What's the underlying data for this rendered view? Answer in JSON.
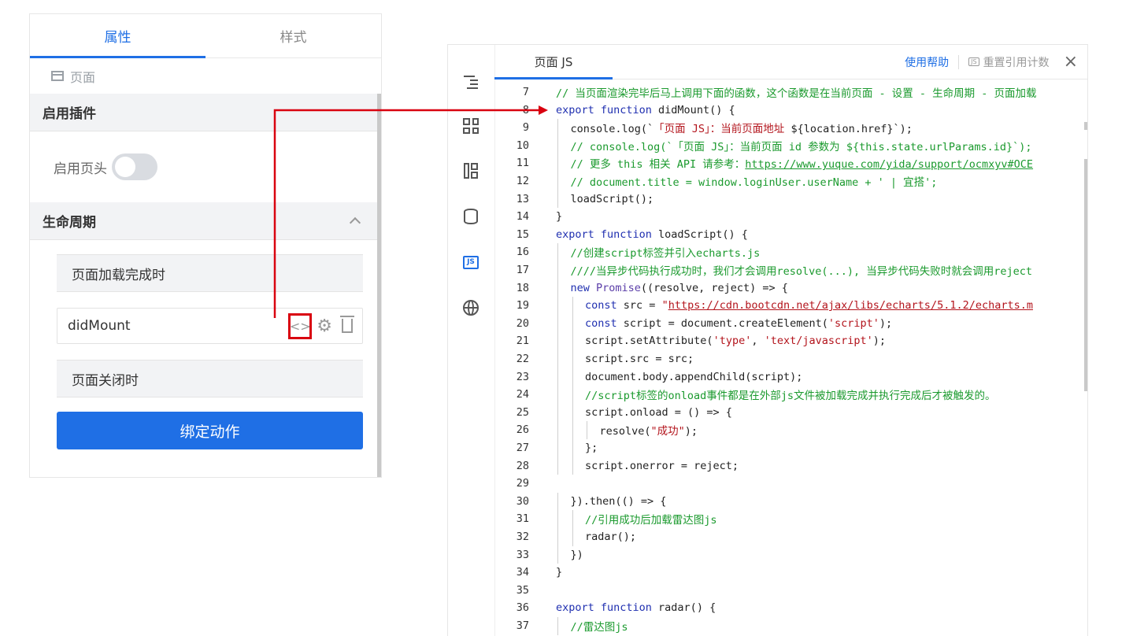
{
  "props_panel": {
    "tabs": [
      {
        "label": "属性",
        "active": true
      },
      {
        "label": "样式",
        "active": false
      }
    ],
    "page_label": "页面",
    "plugin_section": {
      "title": "启用插件",
      "toggle_label": "启用页头",
      "toggle_on": false
    },
    "lifecycle_section": {
      "title": "生命周期",
      "load_header": "页面加载完成时",
      "load_action": "didMount",
      "close_header": "页面关闭时",
      "bind_button": "绑定动作"
    }
  },
  "editor": {
    "tab_label": "页面 JS",
    "help_link": "使用帮助",
    "reset_label": "重置引用计数",
    "reset_badge": "JS",
    "close_icon": "×",
    "sidebar_icons": [
      "outline-icon",
      "components-icon",
      "layout-icon",
      "datasource-icon",
      "js-icon",
      "globe-icon"
    ],
    "active_sidebar": "js-icon",
    "lines": [
      {
        "n": "7",
        "indent": 0,
        "tokens": [
          {
            "t": "// 当页面渲染完毕后马上调用下面的函数，这个函数是在当前页面 - 设置 - 生命周期 - 页面加载",
            "c": "comment"
          }
        ]
      },
      {
        "n": "8",
        "indent": 0,
        "tokens": [
          {
            "t": "export function ",
            "c": "kw"
          },
          {
            "t": "didMount() {",
            "c": "plain"
          }
        ]
      },
      {
        "n": "9",
        "indent": 1,
        "tokens": [
          {
            "t": "console.log(`「页面 JS」：当前页面地址 ${location.href}`);",
            "c": "mixed9"
          }
        ]
      },
      {
        "n": "10",
        "indent": 1,
        "tokens": [
          {
            "t": "// console.log(`「页面 JS」：当前页面 id 参数为 ${this.state.urlParams.id}`);",
            "c": "comment"
          }
        ]
      },
      {
        "n": "11",
        "indent": 1,
        "tokens": [
          {
            "t": "// 更多 this 相关 API 请参考：",
            "c": "comment"
          },
          {
            "t": "https://www.yuque.com/yida/support/ocmxyv#OCE",
            "c": "commentlink"
          }
        ]
      },
      {
        "n": "12",
        "indent": 1,
        "tokens": [
          {
            "t": "// document.title = window.loginUser.userName + ' | 宜搭';",
            "c": "comment"
          }
        ]
      },
      {
        "n": "13",
        "indent": 1,
        "tokens": [
          {
            "t": "loadScript();",
            "c": "plain"
          }
        ]
      },
      {
        "n": "14",
        "indent": 0,
        "tokens": [
          {
            "t": "}",
            "c": "plain"
          }
        ]
      },
      {
        "n": "15",
        "indent": 0,
        "tokens": [
          {
            "t": "export function ",
            "c": "kw"
          },
          {
            "t": "loadScript() {",
            "c": "plain"
          }
        ]
      },
      {
        "n": "16",
        "indent": 1,
        "tokens": [
          {
            "t": "//创建script标签并引入echarts.js",
            "c": "comment"
          }
        ]
      },
      {
        "n": "17",
        "indent": 1,
        "tokens": [
          {
            "t": "////当异步代码执行成功时，我们才会调用resolve(...), 当异步代码失败时就会调用reject",
            "c": "comment"
          }
        ]
      },
      {
        "n": "18",
        "indent": 1,
        "tokens": [
          {
            "t": "new ",
            "c": "kw"
          },
          {
            "t": "Promise",
            "c": "cls"
          },
          {
            "t": "((resolve, reject) => {",
            "c": "plain"
          }
        ]
      },
      {
        "n": "19",
        "indent": 2,
        "tokens": [
          {
            "t": "const ",
            "c": "kw"
          },
          {
            "t": "src = ",
            "c": "plain"
          },
          {
            "t": "\"",
            "c": "str"
          },
          {
            "t": "https://cdn.bootcdn.net/ajax/libs/echarts/5.1.2/echarts.m",
            "c": "strlink"
          }
        ]
      },
      {
        "n": "20",
        "indent": 2,
        "tokens": [
          {
            "t": "const ",
            "c": "kw"
          },
          {
            "t": "script = document.createElement(",
            "c": "plain"
          },
          {
            "t": "'script'",
            "c": "str"
          },
          {
            "t": ");",
            "c": "plain"
          }
        ]
      },
      {
        "n": "21",
        "indent": 2,
        "tokens": [
          {
            "t": "script.setAttribute(",
            "c": "plain"
          },
          {
            "t": "'type'",
            "c": "str"
          },
          {
            "t": ", ",
            "c": "plain"
          },
          {
            "t": "'text/javascript'",
            "c": "str"
          },
          {
            "t": ");",
            "c": "plain"
          }
        ]
      },
      {
        "n": "22",
        "indent": 2,
        "tokens": [
          {
            "t": "script.src = src;",
            "c": "plain"
          }
        ]
      },
      {
        "n": "23",
        "indent": 2,
        "tokens": [
          {
            "t": "document.body.appendChild(script);",
            "c": "plain"
          }
        ]
      },
      {
        "n": "24",
        "indent": 2,
        "tokens": [
          {
            "t": "//script标签的onload事件都是在外部js文件被加载完成并执行完成后才被触发的。",
            "c": "comment"
          }
        ]
      },
      {
        "n": "25",
        "indent": 2,
        "tokens": [
          {
            "t": "script.onload = () => {",
            "c": "plain"
          }
        ]
      },
      {
        "n": "26",
        "indent": 3,
        "tokens": [
          {
            "t": "resolve(",
            "c": "plain"
          },
          {
            "t": "\"成功\"",
            "c": "str"
          },
          {
            "t": ");",
            "c": "plain"
          }
        ]
      },
      {
        "n": "27",
        "indent": 2,
        "tokens": [
          {
            "t": "};",
            "c": "plain"
          }
        ]
      },
      {
        "n": "28",
        "indent": 2,
        "tokens": [
          {
            "t": "script.onerror = reject;",
            "c": "plain"
          }
        ]
      },
      {
        "n": "29",
        "indent": 0,
        "tokens": []
      },
      {
        "n": "30",
        "indent": 1,
        "tokens": [
          {
            "t": "}).then(() => {",
            "c": "plain"
          }
        ]
      },
      {
        "n": "31",
        "indent": 2,
        "tokens": [
          {
            "t": "//引用成功后加载雷达图js",
            "c": "comment"
          }
        ]
      },
      {
        "n": "32",
        "indent": 2,
        "tokens": [
          {
            "t": "radar();",
            "c": "plain"
          }
        ]
      },
      {
        "n": "33",
        "indent": 1,
        "tokens": [
          {
            "t": "})",
            "c": "plain"
          }
        ]
      },
      {
        "n": "34",
        "indent": 0,
        "tokens": [
          {
            "t": "}",
            "c": "plain"
          }
        ]
      },
      {
        "n": "35",
        "indent": 0,
        "tokens": []
      },
      {
        "n": "36",
        "indent": 0,
        "tokens": [
          {
            "t": "export function ",
            "c": "kw"
          },
          {
            "t": "radar() {",
            "c": "plain"
          }
        ]
      },
      {
        "n": "37",
        "indent": 1,
        "tokens": [
          {
            "t": "//雷达图js",
            "c": "comment"
          }
        ]
      }
    ]
  },
  "colors": {
    "accent": "#1f6fe5",
    "annotation": "#d9000f",
    "comment": "#1b9a2e",
    "keyword": "#1f2fb0",
    "string": "#b3141c",
    "class": "#5b3ea8"
  }
}
